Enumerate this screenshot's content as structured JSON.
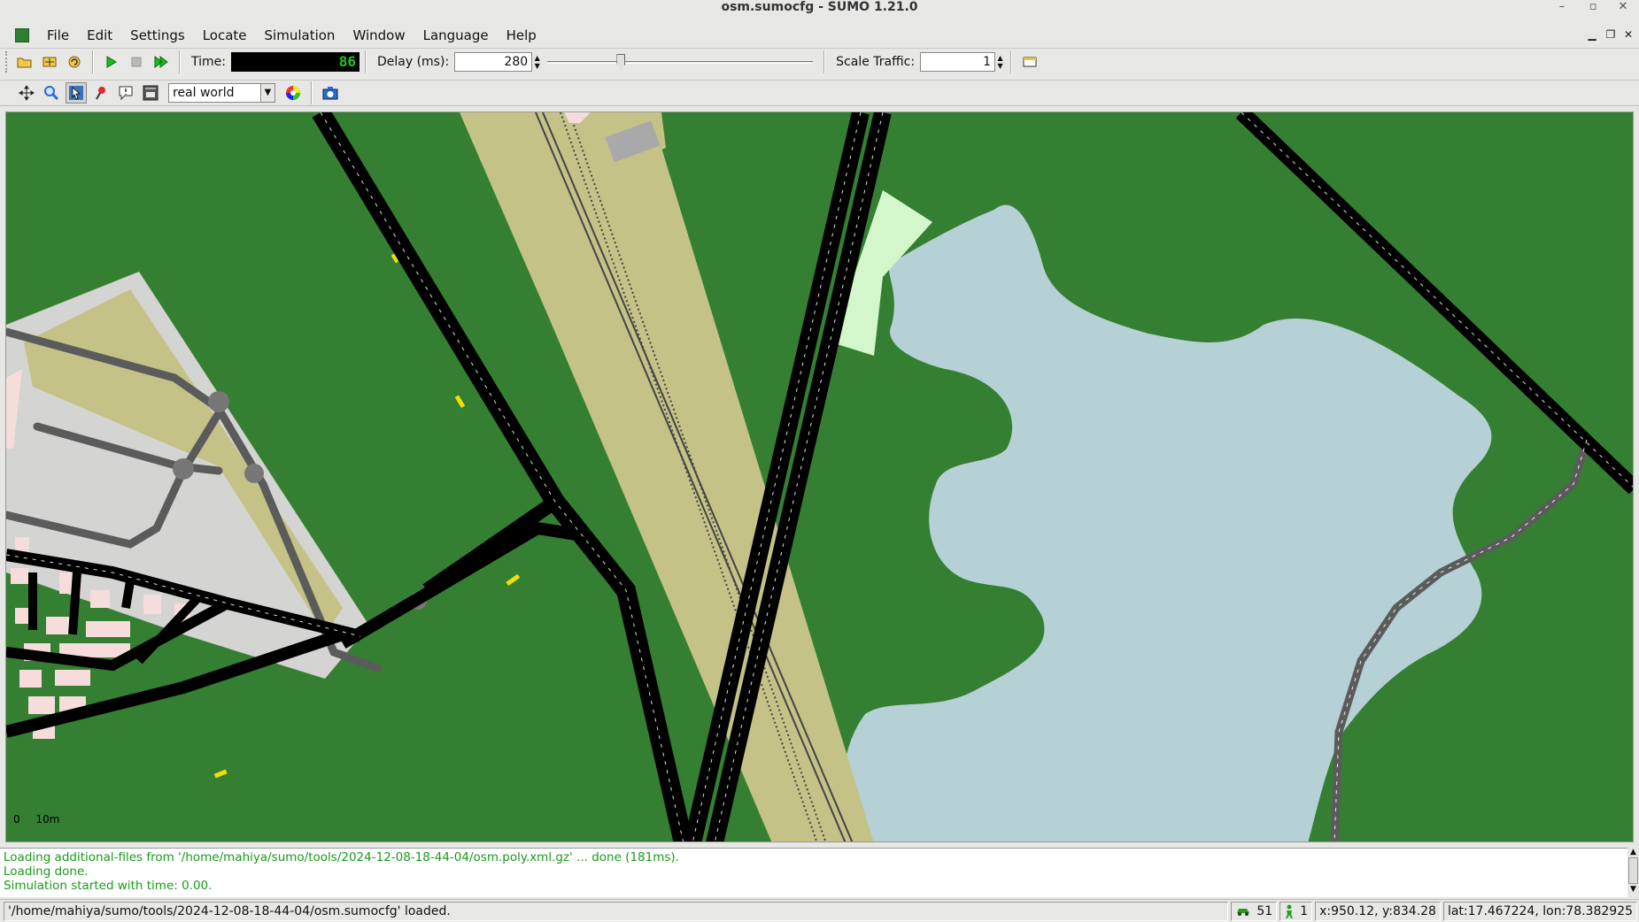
{
  "window": {
    "title": "osm.sumocfg - SUMO 1.21.0",
    "controls": [
      "–",
      "▫",
      "✕"
    ]
  },
  "menubar": {
    "items": [
      "File",
      "Edit",
      "Settings",
      "Locate",
      "Simulation",
      "Window",
      "Language",
      "Help"
    ]
  },
  "toolbar": {
    "time_label": "Time:",
    "time_value": "86",
    "delay_label": "Delay (ms):",
    "delay_value": "280",
    "delay_slider_fraction": 0.27,
    "scale_traffic_label": "Scale Traffic:",
    "scale_traffic_value": "1"
  },
  "view_toolbar": {
    "scheme_selected": "real world"
  },
  "map": {
    "scale_zero": "0",
    "scale_label": "10m",
    "colors": {
      "grass": "#357f33",
      "water": "#b5d1d5",
      "parking": "#d4d4d2",
      "railway_area": "#c4c287",
      "building": "#f7dcdc",
      "light_green": "#d3f7cb",
      "road": "#000000",
      "service_road": "#5b5b5b"
    }
  },
  "log": {
    "lines": [
      "Loading additional-files from '/home/mahiya/sumo/tools/2024-12-08-18-44-04/osm.poly.xml.gz' ... done (181ms).",
      "Loading done.",
      "Simulation started with time: 0.00."
    ]
  },
  "statusbar": {
    "message": "'/home/mahiya/sumo/tools/2024-12-08-18-44-04/osm.sumocfg' loaded.",
    "vehicles": "51",
    "persons": "1",
    "coords": "x:950.12, y:834.28",
    "latlon": "lat:17.467224, lon:78.382925"
  }
}
